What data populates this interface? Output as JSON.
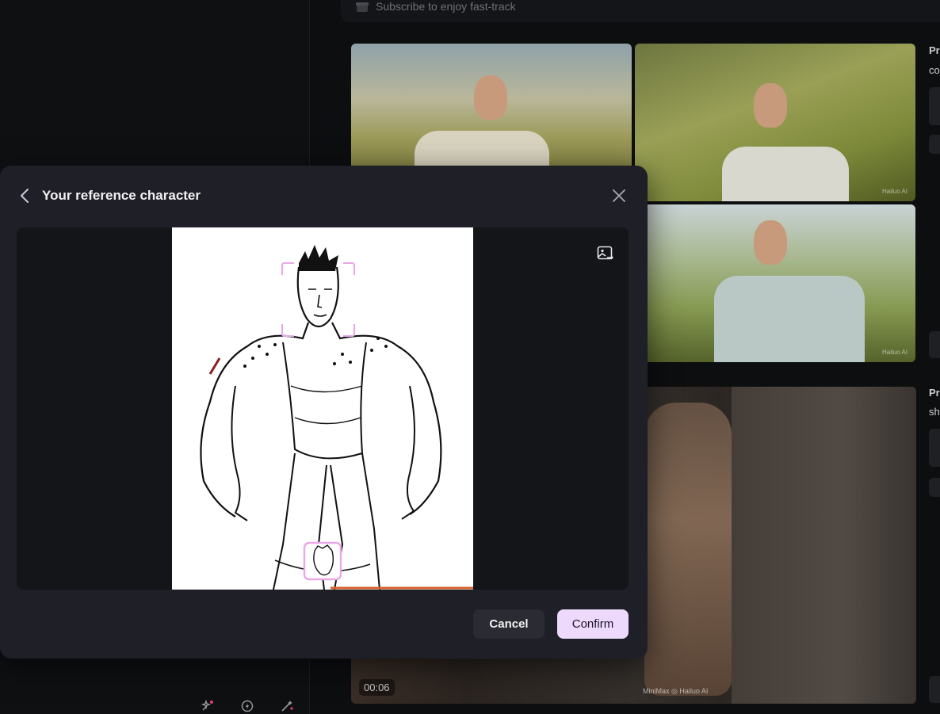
{
  "banner": {
    "text": "Subscribe to enjoy fast-track"
  },
  "gallery": {
    "watermark": "Hailuo AI",
    "video": {
      "duration": "00:06",
      "brand": "MiniMax  ◎ Hailuo AI"
    }
  },
  "side": {
    "label_1": "Pr",
    "label_2": "co",
    "label_3": "Pr",
    "label_4": "sh"
  },
  "modal": {
    "title": "Your reference character",
    "cancel_label": "Cancel",
    "confirm_label": "Confirm"
  },
  "icons": {
    "back": "chevron-left-icon",
    "close": "close-icon",
    "replace_image": "image-replace-icon"
  },
  "colors": {
    "modal_bg": "#1f1f27",
    "confirm_bg": "#ecd9fb",
    "face_marker": "#e9a8e8"
  }
}
